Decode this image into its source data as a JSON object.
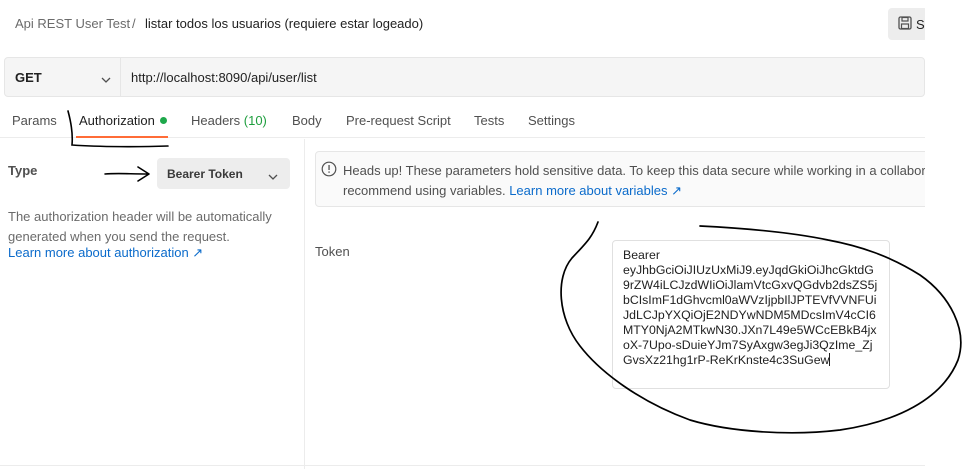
{
  "breadcrumb": {
    "collection": "Api REST User Test",
    "separator": "/",
    "request_name": "listar todos los usuarios (requiere estar logeado)"
  },
  "toolbar": {
    "save_label": "S"
  },
  "request": {
    "method": "GET",
    "url": "http://localhost:8090/api/user/list"
  },
  "tabs": [
    {
      "label": "Params"
    },
    {
      "label": "Authorization"
    },
    {
      "label": "Headers",
      "count": "(10)"
    },
    {
      "label": "Body"
    },
    {
      "label": "Pre-request Script"
    },
    {
      "label": "Tests"
    },
    {
      "label": "Settings"
    }
  ],
  "auth": {
    "type_label": "Type",
    "type_value": "Bearer Token",
    "description": "The authorization header will be automatically generated when you send the request.",
    "learn_more": "Learn more about authorization ↗"
  },
  "notice": {
    "line1": "Heads up! These parameters hold sensitive data. To keep this data secure while working in a collabora",
    "line2": "recommend using variables. ",
    "link": "Learn more about variables ↗"
  },
  "token": {
    "label": "Token",
    "value": "Bearer\neyJhbGciOiJIUzUxMiJ9.eyJqdGkiOiJhcGktdG9rZW4iLCJzdWIiOiJlamVtcGxvQGdvb2dsZS5jbCIsImF1dGhvcml0aWVzIjpbIlJPTEVfVVNFUiJdLCJpYXQiOjE2NDYwNDM5MDcsImV4cCI6MTY0NjA2MTkwN30.JXn7L49e5WCcEBkB4jxoX-7Upo-sDuieYJm7SyAxgw3egJi3QzIme_ZjGvsXz21hg1rP-ReKrKnste4c3SuGew"
  },
  "colors": {
    "accent": "#ff6c37",
    "link": "#0b6bcb",
    "status_green": "#1ea84b"
  },
  "icons": [
    "save-icon",
    "chevron-down-icon",
    "info-icon"
  ]
}
